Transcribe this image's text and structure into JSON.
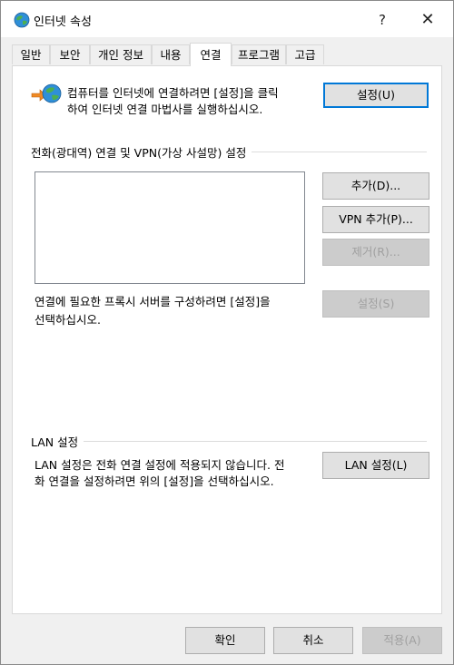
{
  "window": {
    "title": "인터넷 속성",
    "help_glyph": "?",
    "close_glyph": "✕"
  },
  "tabs": [
    {
      "label": "일반",
      "active": false
    },
    {
      "label": "보안",
      "active": false
    },
    {
      "label": "개인 정보",
      "active": false
    },
    {
      "label": "내용",
      "active": false
    },
    {
      "label": "연결",
      "active": true
    },
    {
      "label": "프로그램",
      "active": false
    },
    {
      "label": "고급",
      "active": false
    }
  ],
  "setup": {
    "description_line1": "컴퓨터를 인터넷에 연결하려면 [설정]을 클릭",
    "description_line2": "하여 인터넷 연결 마법사를 실행하십시오.",
    "setup_button": "설정(U)"
  },
  "dialup": {
    "group_title": "전화(광대역) 연결 및 VPN(가상 사설망) 설정",
    "add_button": "추가(D)...",
    "add_vpn_button": "VPN 추가(P)...",
    "remove_button": "제거(R)...",
    "settings_button": "설정(S)",
    "proxy_text_line1": "연결에 필요한 프록시 서버를 구성하려면 [설정]을",
    "proxy_text_line2": "선택하십시오."
  },
  "lan": {
    "group_title": "LAN 설정",
    "text_line1": "LAN 설정은 전화 연결 설정에 적용되지 않습니다. 전",
    "text_line2": "화 연결을 설정하려면 위의 [설정]을 선택하십시오.",
    "button": "LAN 설정(L)"
  },
  "footer": {
    "ok_button": "확인",
    "cancel_button": "취소",
    "apply_button": "적용(A)"
  },
  "colors": {
    "accent": "#0078d7",
    "disabled_text": "#a0a0a0"
  }
}
